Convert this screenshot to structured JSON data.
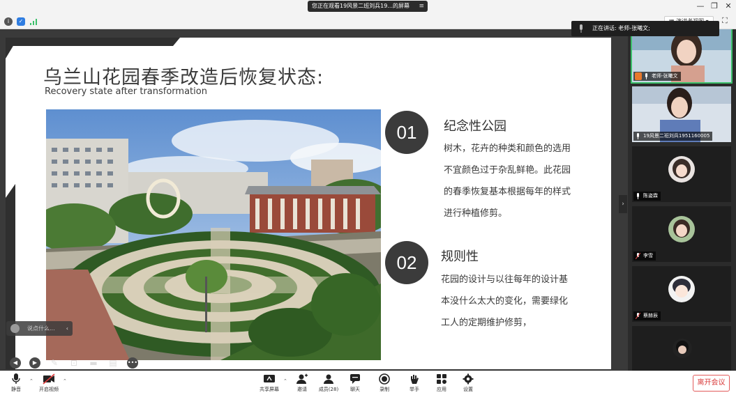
{
  "title_bar": {
    "viewing_text": "您正在观看19风景二班刘兵19...的屏幕",
    "minimize_glyph": "—",
    "restore_glyph": "❐",
    "close_glyph": "✕"
  },
  "sub_toolbar": {
    "view_button_label": "▦ 演讲者视图 ▾"
  },
  "speaking_banner": "正在讲话: 老师-张曦文;",
  "slide": {
    "title": "乌兰山花园春季改造后恢复状态:",
    "subtitle": "Recovery state after transformation",
    "sections": [
      {
        "number": "01",
        "heading": "纪念性公园",
        "lines": [
          "树木，花卉的种类和颜色的选用",
          "不宜颜色过于杂乱鲜艳。此花园",
          "的春季恢复基本根据每年的样式",
          "进行种植修剪。"
        ]
      },
      {
        "number": "02",
        "heading": "规则性",
        "lines": [
          "花园的设计与以往每年的设计基",
          "本没什么太大的变化，需要绿化",
          "工人的定期维护修剪，"
        ]
      }
    ]
  },
  "chat_input": {
    "placeholder": "说点什么..."
  },
  "participants": [
    {
      "name": "老师-张曦文",
      "active": true
    },
    {
      "name": "19风景二班刘兵1951160005",
      "active": false
    },
    {
      "name": "陈姿霖",
      "active": false
    },
    {
      "name": "李雪",
      "active": false
    },
    {
      "name": "蔡赫辰",
      "active": false
    }
  ],
  "toolbar": {
    "mute": "静音",
    "start_video": "开启视频",
    "share_screen": "共享屏幕",
    "invite": "邀请",
    "members": "成员(28)",
    "chat": "聊天",
    "record": "录制",
    "raise_hand": "举手",
    "apps": "应用",
    "settings": "设置",
    "leave": "离开会议"
  },
  "colors": {
    "active_speaker": "#3cc06b",
    "leave": "#d93a3a",
    "slide_dark": "#3b3b3b"
  }
}
